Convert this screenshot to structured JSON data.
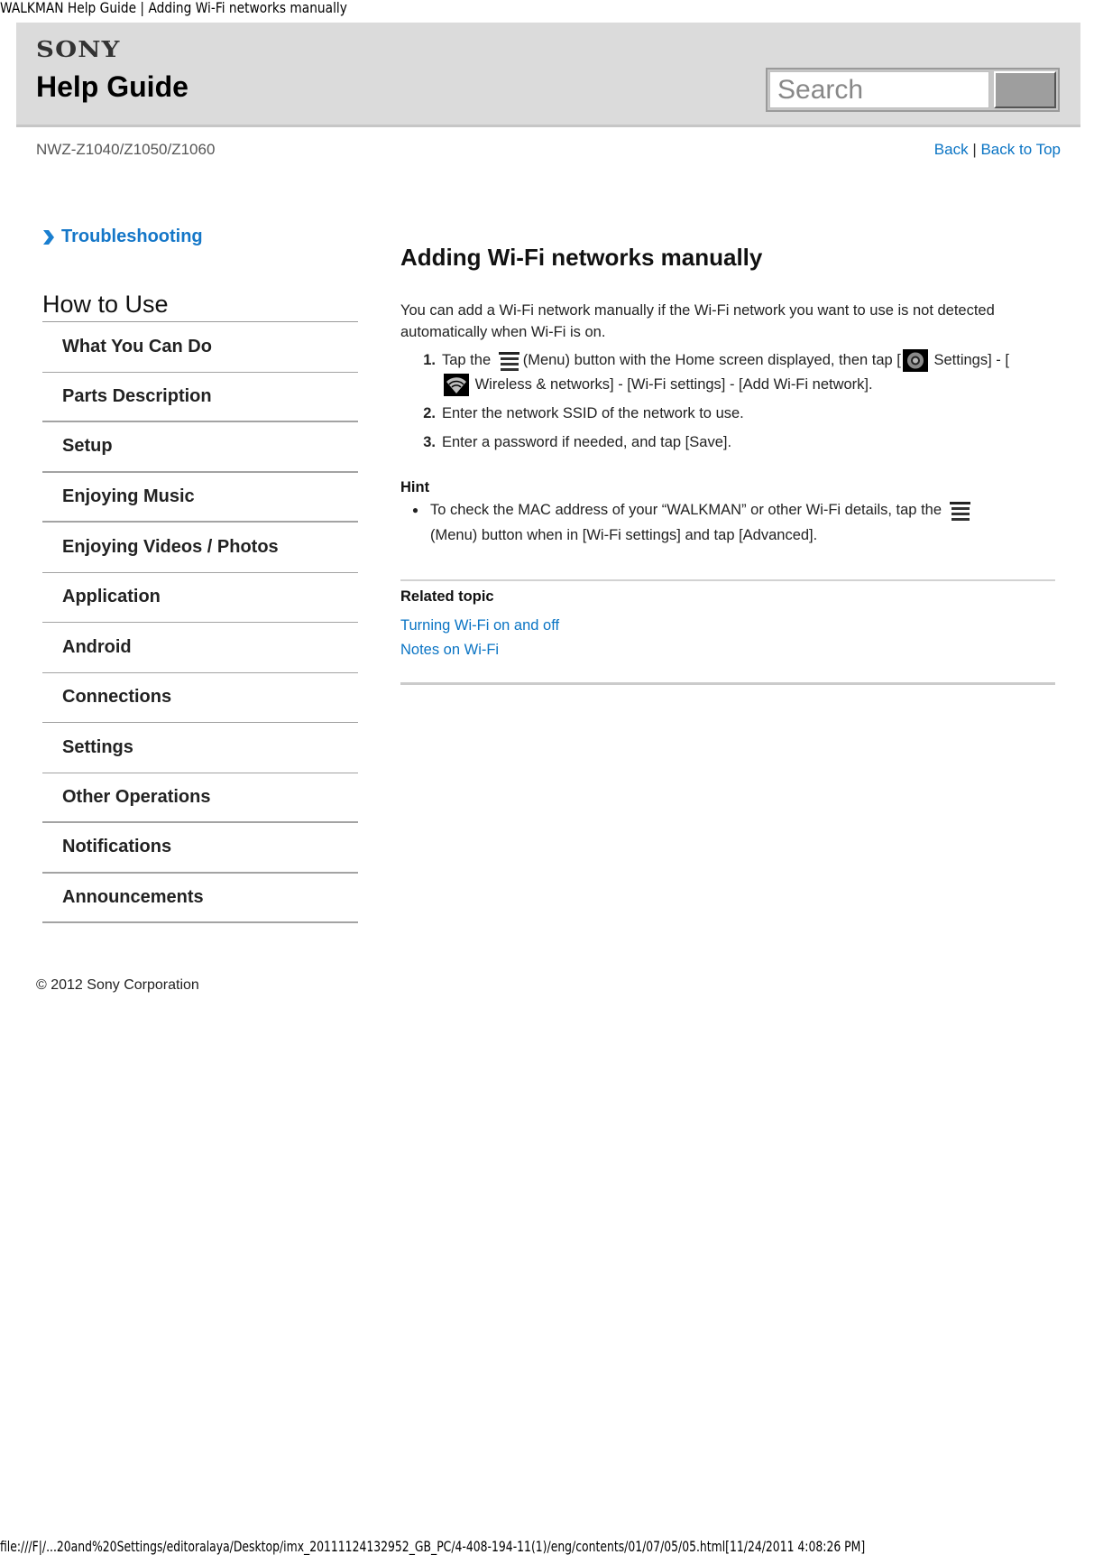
{
  "print_header": {
    "title": "WALKMAN Help Guide | Adding Wi-Fi networks manually"
  },
  "header": {
    "brand": "SONY",
    "title": "Help Guide",
    "search": {
      "placeholder": "Search",
      "value": "",
      "button_label": ""
    }
  },
  "subheader": {
    "model": "NWZ-Z1040/Z1050/Z1060",
    "back_label": "Back",
    "separator": "|",
    "back_to_top_label": "Back to Top"
  },
  "sidebar": {
    "troubleshooting": {
      "label": "Troubleshooting",
      "icon": "chevron-right-icon"
    },
    "section_title": "How to Use",
    "items": [
      {
        "label": "What You Can Do"
      },
      {
        "label": "Parts Description"
      },
      {
        "label": "Setup"
      },
      {
        "label": "Enjoying Music"
      },
      {
        "label": "Enjoying Videos / Photos"
      },
      {
        "label": "Application"
      },
      {
        "label": "Android"
      },
      {
        "label": "Connections"
      },
      {
        "label": "Settings"
      },
      {
        "label": "Other Operations"
      },
      {
        "label": "Notifications"
      },
      {
        "label": "Announcements"
      }
    ],
    "copyright": "© 2012 Sony Corporation"
  },
  "article": {
    "title": "Adding Wi-Fi networks manually",
    "intro": "You can add a Wi-Fi network manually if the Wi-Fi network you want to use is not detected automatically when Wi-Fi is on.",
    "steps": [
      {
        "number": "1.",
        "parts": {
          "a": "Tap the",
          "b": "(Menu) button with the Home screen displayed, then tap [",
          "c": "Settings] - [",
          "d": "Wireless & networks] - [Wi-Fi settings] - [Add Wi-Fi network]."
        },
        "icons": [
          "menu-icon",
          "settings-icon",
          "wifi-icon"
        ]
      },
      {
        "number": "2.",
        "text": "Enter the network SSID of the network to use."
      },
      {
        "number": "3.",
        "text": "Enter a password if needed, and tap [Save]."
      }
    ],
    "hint": {
      "label": "Hint",
      "items": [
        {
          "before": "To check the MAC address of your “WALKMAN” or other Wi-Fi details, tap the",
          "after": "(Menu) button when in [Wi-Fi settings] and tap [Advanced].",
          "icon": "menu-icon"
        }
      ]
    },
    "related": {
      "label": "Related topic",
      "links": [
        {
          "label": "Turning Wi-Fi on and off"
        },
        {
          "label": "Notes on Wi-Fi"
        }
      ]
    }
  },
  "colors": {
    "link": "#0a74c4",
    "header_bg": "#dbdbdb",
    "troubleshooting": "#1577c8"
  },
  "print_footer": {
    "path": "file:///F|/...20and%20Settings/editoralaya/Desktop/imx_20111124132952_GB_PC/4-408-194-11(1)/eng/contents/01/07/05/05.html[11/24/2011 4:08:26 PM]"
  }
}
